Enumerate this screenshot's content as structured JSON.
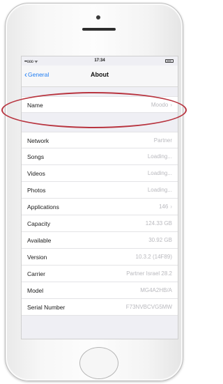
{
  "status_bar": {
    "carrier": "••ooo ᯤ",
    "time": "17:34"
  },
  "navbar": {
    "back_label": "General",
    "title": "About"
  },
  "name_row": {
    "label": "Name",
    "value": "Moodo"
  },
  "rows": [
    {
      "label": "Network",
      "value": "Partner"
    },
    {
      "label": "Songs",
      "value": "Loading..."
    },
    {
      "label": "Videos",
      "value": "Loading..."
    },
    {
      "label": "Photos",
      "value": "Loading..."
    },
    {
      "label": "Applications",
      "value": "146"
    },
    {
      "label": "Capacity",
      "value": "124.33 GB"
    },
    {
      "label": "Available",
      "value": "30.92 GB"
    },
    {
      "label": "Version",
      "value": "10.3.2 (14F89)"
    },
    {
      "label": "Carrier",
      "value": "Partner Israel 28.2"
    },
    {
      "label": "Model",
      "value": "MG4A2HB/A"
    },
    {
      "label": "Serial Number",
      "value": "F73NVBCVG5MW"
    }
  ],
  "icons": {
    "back": "chevron-left-icon",
    "disclosure": "chevron-right-icon",
    "battery": "battery-icon"
  },
  "colors": {
    "accent": "#1e7cf2",
    "highlight_ring": "#b8343f"
  }
}
